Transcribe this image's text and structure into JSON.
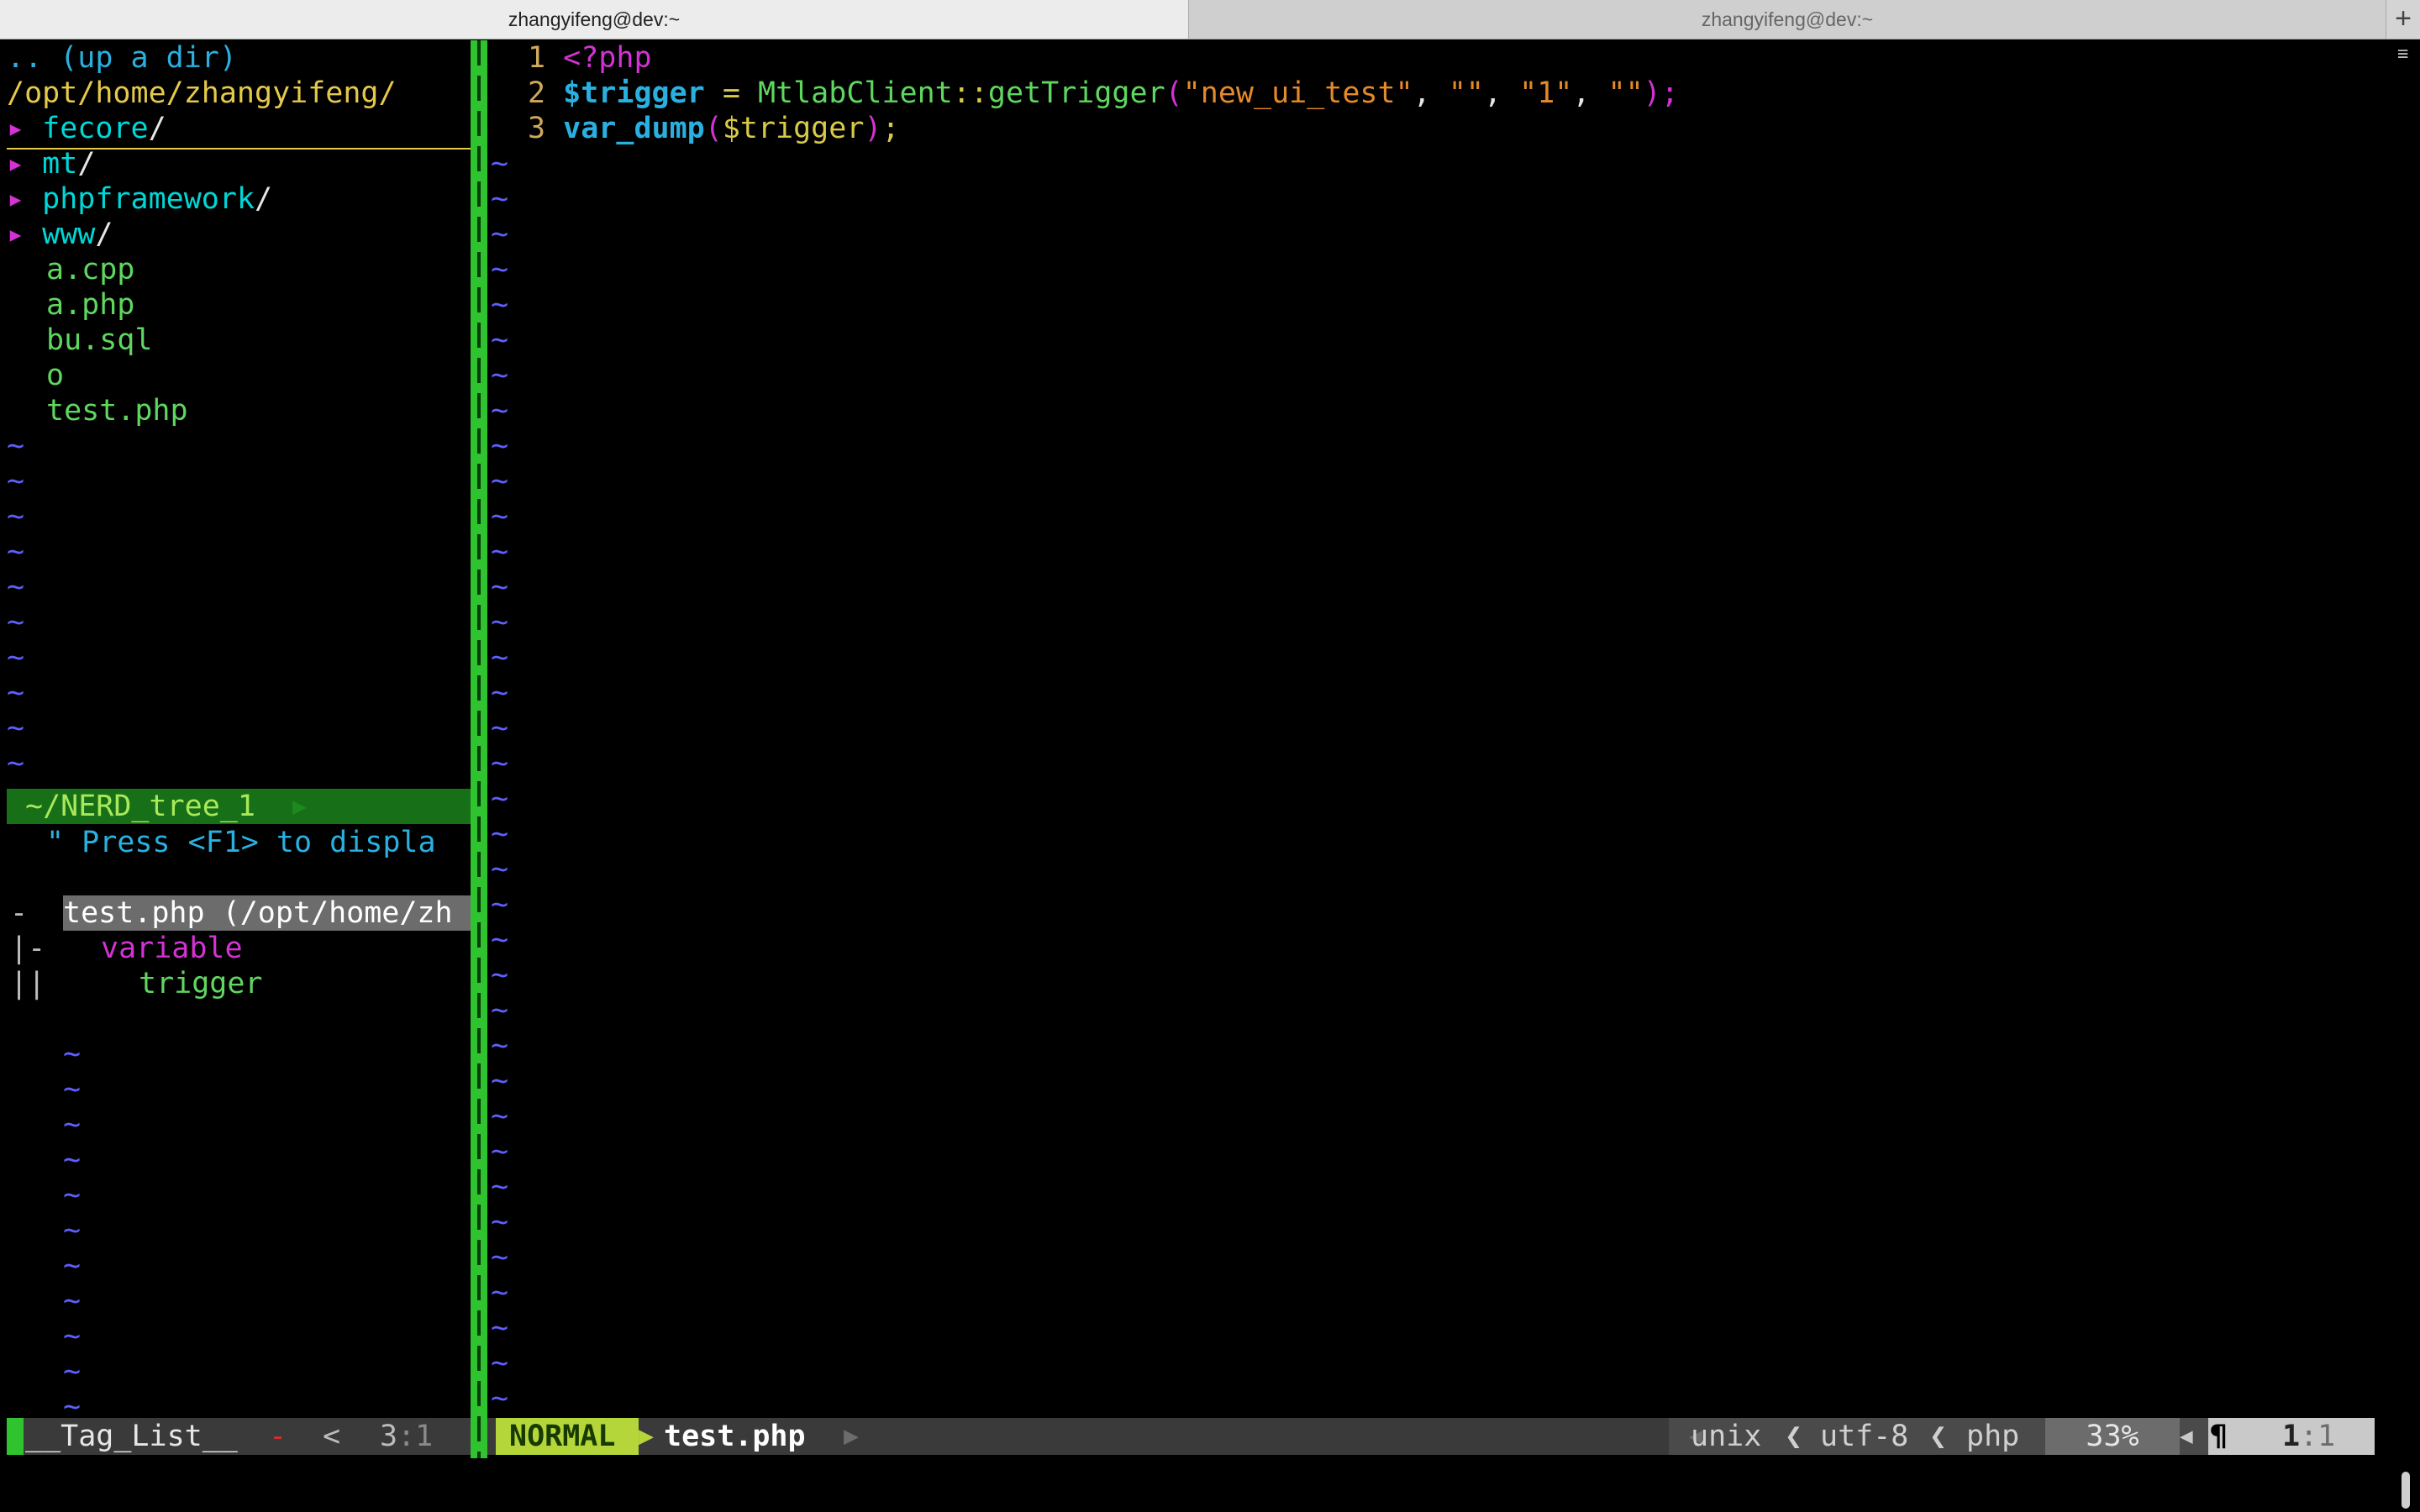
{
  "window": {
    "tabs": [
      {
        "title": "zhangyifeng@dev:~"
      },
      {
        "title": "zhangyifeng@dev:~"
      }
    ],
    "new_tab_icon": "+"
  },
  "nerdtree": {
    "up_dir": ".. (up a dir)",
    "root_path": "/opt/home/zhangyifeng/",
    "dir_arrow": "▸",
    "dirs": [
      "fecore",
      "mt",
      "phpframework",
      "www"
    ],
    "dir_slash": "/",
    "files": [
      "a.cpp",
      "a.php",
      "bu.sql",
      "o",
      "test.php"
    ],
    "statusline_label": "~/NERD_tree_1"
  },
  "taglist": {
    "hint": "\" Press <F1> to displa",
    "file_prefix": "-",
    "file_entry": "test.php (/opt/home/zh",
    "kind_prefix": "|-",
    "kind": "variable",
    "tag_prefix": "||",
    "tag": "trigger"
  },
  "editor": {
    "line_numbers": [
      "1",
      "2",
      "3"
    ],
    "line1": {
      "tag": "<?php"
    },
    "line2": {
      "var": "$trigger",
      "op": "=",
      "cls": "MtlabClient",
      "sep": "::",
      "fn": "getTrigger",
      "open": "(",
      "arg1": "\"new_ui_test\"",
      "arg2": "\"\"",
      "arg3": "\"1\"",
      "arg4": "\"\"",
      "comma": ",",
      "close": ");"
    },
    "line3": {
      "fn": "var_dump",
      "open": "(",
      "var": "$trigger",
      "close": ")",
      "semi": ";"
    },
    "empty_marker": "~"
  },
  "statusline": {
    "left_name": "__Tag_List__",
    "left_flag": "-",
    "left_sep": "<",
    "left_pos_line": "3",
    "left_pos_col": ":1",
    "mode": "NORMAL",
    "file": "test.php",
    "fileformat": "unix",
    "encoding": "utf-8",
    "filetype": "php",
    "percent": "33%",
    "pos_line": "1",
    "pos_col": ":1",
    "sep_icon": "❮",
    "line_icon": "¶"
  },
  "scrollbar": {
    "menu_icon": "≡"
  }
}
